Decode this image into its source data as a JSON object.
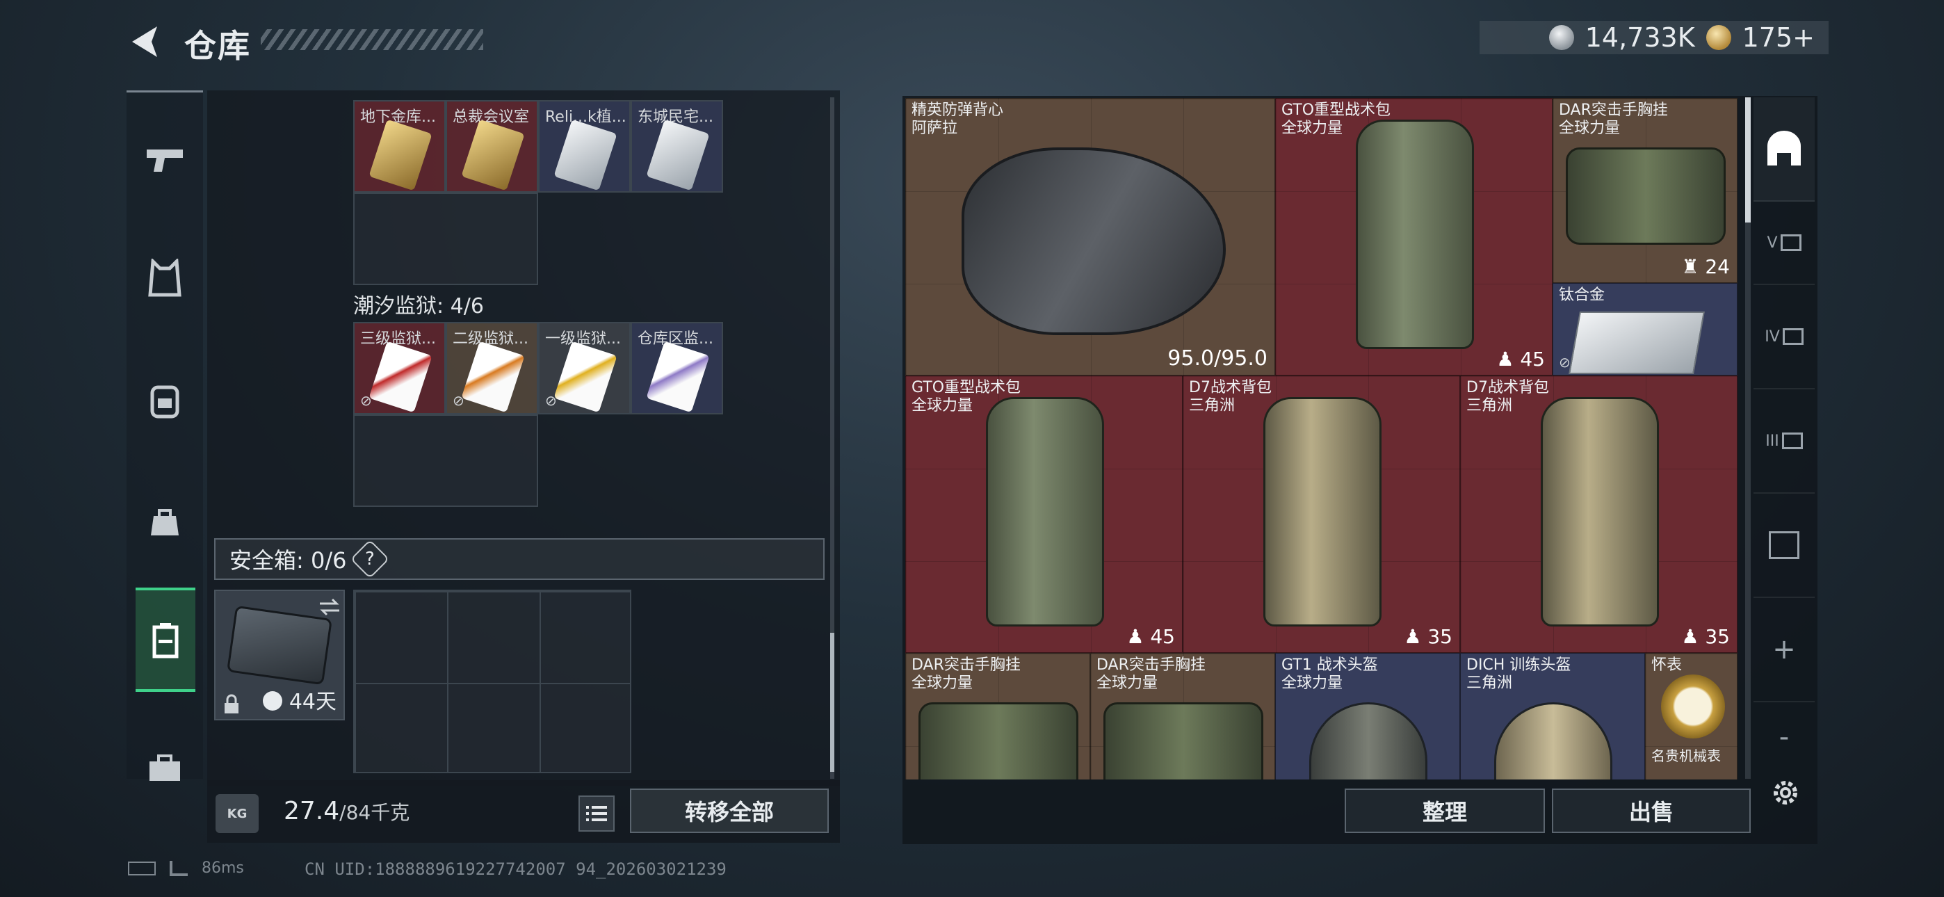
{
  "header": {
    "title": "仓库",
    "currency_silver": "14,733K",
    "currency_gold": "175+"
  },
  "left_rail": {
    "items": [
      {
        "icon": "pistol-icon"
      },
      {
        "icon": "vest-icon"
      },
      {
        "icon": "backpack-icon"
      },
      {
        "icon": "pouch-icon"
      },
      {
        "icon": "safe-case-icon",
        "active": true
      },
      {
        "icon": "briefcase-icon"
      }
    ]
  },
  "keycards": {
    "row1": [
      {
        "label": "地下金库...",
        "color": "gold"
      },
      {
        "label": "总裁会议室",
        "color": "gold"
      },
      {
        "label": "Reli...k植...",
        "color": "silver"
      },
      {
        "label": "东城民宅...",
        "color": "silver"
      }
    ],
    "prison_label": "潮汐监狱: 4/6",
    "row2": [
      {
        "label": "三级监狱...",
        "color": "red"
      },
      {
        "label": "二级监狱...",
        "color": "orange"
      },
      {
        "label": "一级监狱...",
        "color": "yellow"
      },
      {
        "label": "仓库区监...",
        "color": "purple"
      }
    ]
  },
  "safe": {
    "label": "安全箱: 0/6",
    "help": "?",
    "days": "44天"
  },
  "bottom_left": {
    "weight_icon_text": "KG",
    "weight_value": "27.4",
    "weight_max": "/84千克",
    "transfer_all": "转移全部"
  },
  "storage": {
    "items": [
      {
        "line1": "精英防弹背心",
        "line2": "阿萨拉",
        "value": "95.0/95.0"
      },
      {
        "line1": "GTO重型战术包",
        "line2": "全球力量",
        "count": "45"
      },
      {
        "line1": "DAR突击手胸挂",
        "line2": "全球力量",
        "count": "24"
      },
      {
        "line1": "钛合金"
      },
      {
        "line1": "GTO重型战术包",
        "line2": "全球力量",
        "count": "45"
      },
      {
        "line1": "D7战术背包",
        "line2": "三角洲",
        "count": "35"
      },
      {
        "line1": "D7战术背包",
        "line2": "三角洲",
        "count": "35"
      },
      {
        "line1": "DAR突击手胸挂",
        "line2": "全球力量"
      },
      {
        "line1": "DAR突击手胸挂",
        "line2": "全球力量"
      },
      {
        "line1": "GT1 战术头盔",
        "line2": "全球力量"
      },
      {
        "line1": "DICH 训练头盔",
        "line2": "三角洲"
      },
      {
        "line1": "怀表",
        "line2": "名贵机械表"
      }
    ],
    "sort": "整理",
    "sell": "出售"
  },
  "right_tabs": [
    "",
    "V",
    "IV",
    "III",
    "",
    "+",
    "-"
  ],
  "footer": {
    "ping": "86ms",
    "uid": "CN UID:1888889619227742007 94_202603021239"
  }
}
